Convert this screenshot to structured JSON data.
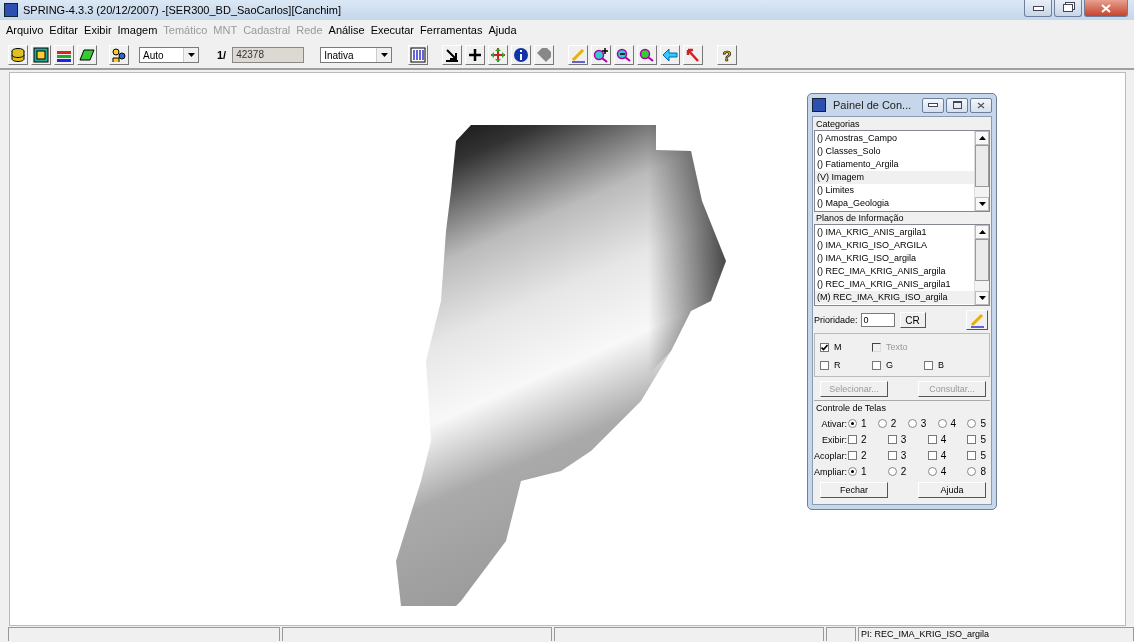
{
  "window": {
    "title": "SPRING-4.3.3 (20/12/2007) -[SER300_BD_SaoCarlos][Canchim]"
  },
  "menu": [
    {
      "label": "Arquivo",
      "disabled": false
    },
    {
      "label": "Editar",
      "disabled": false
    },
    {
      "label": "Exibir",
      "disabled": false
    },
    {
      "label": "Imagem",
      "disabled": false
    },
    {
      "label": "Temático",
      "disabled": true
    },
    {
      "label": "MNT",
      "disabled": true
    },
    {
      "label": "Cadastral",
      "disabled": true
    },
    {
      "label": "Rede",
      "disabled": true
    },
    {
      "label": "Análise",
      "disabled": false
    },
    {
      "label": "Executar",
      "disabled": false
    },
    {
      "label": "Ferramentas",
      "disabled": false
    },
    {
      "label": "Ajuda",
      "disabled": false
    }
  ],
  "toolbar": {
    "scale_mode": "Auto",
    "scale_prefix": "1/",
    "scale_value": "42378",
    "cursor_mode": "Inativa",
    "help_glyph": "?"
  },
  "panel": {
    "title": "Painel de Con...",
    "categories_label": "Categorias",
    "categories": [
      {
        "label": "() Amostras_Campo",
        "selected": false
      },
      {
        "label": "() Classes_Solo",
        "selected": false
      },
      {
        "label": "() Fatiamento_Argila",
        "selected": false
      },
      {
        "label": "(V) Imagem",
        "selected": true
      },
      {
        "label": "() Limites",
        "selected": false
      },
      {
        "label": "() Mapa_Geologia",
        "selected": false
      }
    ],
    "planes_label": "Planos de Informação",
    "planes": [
      {
        "label": "() IMA_KRIG_ANIS_argila1",
        "selected": false
      },
      {
        "label": "() IMA_KRIG_ISO_ARGILA",
        "selected": false
      },
      {
        "label": "() IMA_KRIG_ISO_argila",
        "selected": false
      },
      {
        "label": "() REC_IMA_KRIG_ANIS_argila",
        "selected": false
      },
      {
        "label": "() REC_IMA_KRIG_ANIS_argila1",
        "selected": false
      },
      {
        "label": "(M) REC_IMA_KRIG_ISO_argila",
        "selected": true
      }
    ],
    "priority_label": "Prioridade:",
    "priority_value": "0",
    "cr_button": "CR",
    "bands": [
      [
        {
          "label": "M",
          "checked": true,
          "disabled": false
        },
        {
          "label": "Texto",
          "checked": false,
          "disabled": true
        }
      ],
      [
        {
          "label": "R",
          "checked": false,
          "disabled": false
        },
        {
          "label": "G",
          "checked": false,
          "disabled": false
        },
        {
          "label": "B",
          "checked": false,
          "disabled": false
        }
      ]
    ],
    "select_button": "Selecionar...",
    "query_button": "Consultar...",
    "screens_label": "Controle de Telas",
    "screens": [
      {
        "label": "Ativar:",
        "kind": "radio",
        "options": [
          {
            "label": "1",
            "selected": true
          },
          {
            "label": "2",
            "selected": false
          },
          {
            "label": "3",
            "selected": false
          },
          {
            "label": "4",
            "selected": false
          },
          {
            "label": "5",
            "selected": false
          }
        ]
      },
      {
        "label": "Exibir:",
        "kind": "checkbox",
        "options": [
          {
            "label": "2",
            "checked": false
          },
          {
            "label": "3",
            "checked": false
          },
          {
            "label": "4",
            "checked": false
          },
          {
            "label": "5",
            "checked": false
          }
        ]
      },
      {
        "label": "Acoplar:",
        "kind": "checkbox",
        "options": [
          {
            "label": "2",
            "checked": false
          },
          {
            "label": "3",
            "checked": false
          },
          {
            "label": "4",
            "checked": false
          },
          {
            "label": "5",
            "checked": false
          }
        ]
      },
      {
        "label": "Ampliar:",
        "kind": "radio",
        "options": [
          {
            "label": "1",
            "selected": true
          },
          {
            "label": "2",
            "selected": false
          },
          {
            "label": "4",
            "selected": false
          },
          {
            "label": "8",
            "selected": false
          }
        ]
      }
    ],
    "close_button": "Fechar",
    "help_button": "Ajuda"
  },
  "status_bar": {
    "plane": "PI: REC_IMA_KRIG_ISO_argila"
  }
}
